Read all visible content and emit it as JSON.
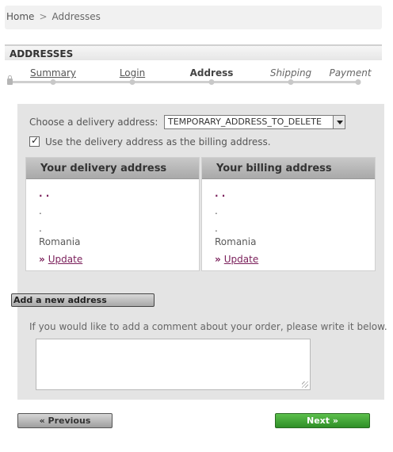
{
  "breadcrumb": {
    "home": "Home",
    "separator": ">",
    "current": "Addresses"
  },
  "page_title": "ADDRESSES",
  "steps": [
    {
      "label": "Summary",
      "state": "done"
    },
    {
      "label": "Login",
      "state": "done"
    },
    {
      "label": "Address",
      "state": "current"
    },
    {
      "label": "Shipping",
      "state": "todo"
    },
    {
      "label": "Payment",
      "state": "todo"
    }
  ],
  "delivery_select": {
    "label": "Choose a delivery address:",
    "value": "TEMPORARY_ADDRESS_TO_DELETE"
  },
  "billing_checkbox": {
    "label": "Use the delivery address as the billing address.",
    "checked": true
  },
  "delivery_address": {
    "title": "Your delivery address",
    "name_line": ". .",
    "line2": ".",
    "line3": ".",
    "country": "Romania",
    "update_label": "Update"
  },
  "billing_address": {
    "title": "Your billing address",
    "name_line": ". .",
    "line2": ".",
    "line3": ".",
    "country": "Romania",
    "update_label": "Update"
  },
  "add_address_label": "Add a new address",
  "comment": {
    "prompt": "If you would like to add a comment about your order, please write it below.",
    "value": ""
  },
  "nav": {
    "previous_label": "« Previous",
    "next_label": "Next »"
  },
  "colors": {
    "accent": "#7a1f5a",
    "next_button": "#3a9a30",
    "panel_bg": "#e4e4e4"
  },
  "icons": [
    "lock-icon",
    "checkbox-check-icon",
    "dropdown-arrow-icon",
    "double-chevron-icon",
    "resize-grip-icon"
  ]
}
